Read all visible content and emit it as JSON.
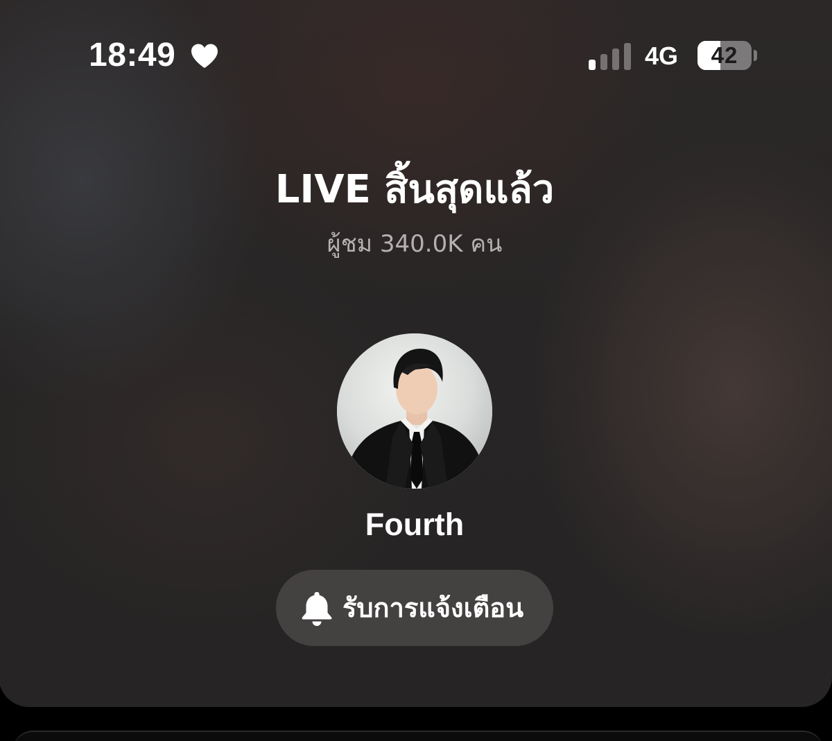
{
  "status_bar": {
    "time": "18:49",
    "heart_icon": "heart-icon",
    "signal_icon": "cellular-signal-icon",
    "signal_bars_active": 1,
    "signal_bars_total": 4,
    "network": "4G",
    "battery_level": "42",
    "battery_fraction": 0.42
  },
  "live_ended": {
    "title": "LIVE สิ้นสุดแล้ว",
    "viewers": "ผู้ชม 340.0K คน"
  },
  "host": {
    "avatar": "host-profile-photo",
    "name": "Fourth"
  },
  "notify_button": {
    "icon": "bell-icon",
    "label": "รับการแจ้งเตือน"
  },
  "colors": {
    "background": "#272525",
    "text_primary": "#ffffff",
    "text_secondary": "#b4b1b1",
    "button_background": "#4a4646"
  }
}
